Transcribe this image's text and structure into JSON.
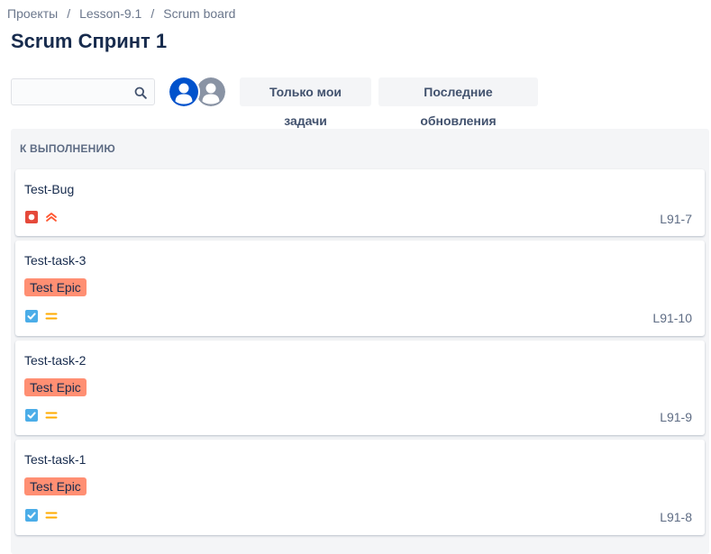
{
  "breadcrumbs": [
    "Проекты",
    "Lesson-9.1",
    "Scrum board"
  ],
  "breadcrumb_separator": "/",
  "title": "Scrum Спринт 1",
  "search": {
    "value": "",
    "placeholder": ""
  },
  "avatars": [
    {
      "name": "avatar-current-user",
      "color": "#0052cc"
    },
    {
      "name": "avatar-default-user",
      "color": "#8993a4"
    }
  ],
  "filters": {
    "mine": "Только мои задачи",
    "recent": "Последние обновления"
  },
  "column": {
    "title": "К ВЫПОЛНЕНИЮ",
    "cards": [
      {
        "summary": "Test-Bug",
        "epic": "",
        "type": "bug",
        "priority": "highest",
        "key": "L91-7"
      },
      {
        "summary": "Test-task-3",
        "epic": "Test Epic",
        "type": "task",
        "priority": "medium",
        "key": "L91-10"
      },
      {
        "summary": "Test-task-2",
        "epic": "Test Epic",
        "type": "task",
        "priority": "medium",
        "key": "L91-9"
      },
      {
        "summary": "Test-task-1",
        "epic": "Test Epic",
        "type": "task",
        "priority": "medium",
        "key": "L91-8"
      }
    ]
  },
  "colors": {
    "bug": "#e5493a",
    "task": "#4bade8",
    "priority_highest": "#ff5630",
    "priority_medium": "#ffab00",
    "epic_label": "#ff8f73"
  }
}
